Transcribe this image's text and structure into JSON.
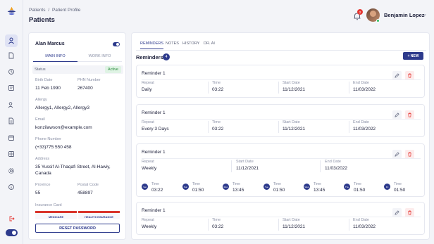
{
  "breadcrumb": {
    "root": "Patients",
    "separator": "/",
    "current": "Patient Profile"
  },
  "page_title": "Patients",
  "header": {
    "notification_count": "2",
    "user_name": "Benjamin Lopez"
  },
  "patient": {
    "name": "Alan Marcus",
    "tabs": [
      "MAIN INFO",
      "WORK INFO"
    ],
    "status_label": "Status",
    "status_value": "Active",
    "birth_date_label": "Birth Date",
    "birth_date": "11 Feb 1990",
    "phn_label": "PHN Number",
    "phn": "267400",
    "allergy_label": "Allergy",
    "allergy": "Allergy1, Allergy2, Allergy3",
    "email_label": "Email",
    "email": "konzilawson@example.com",
    "phone_label": "Phone Number",
    "phone": "(+33)775 550 458",
    "address_label": "Address",
    "address": "35 Yussif Al-Thaqafi Street, Al-Hawiy, Canada",
    "province_label": "Province",
    "province": "55",
    "postal_label": "Postal Code",
    "postal": "458897",
    "insurance_label": "Insurance Card",
    "insurance_cards": [
      "MEDICARE",
      "HEALTH INSURANCE"
    ],
    "reset_label": "RESET PASSWORD"
  },
  "main": {
    "tabs": [
      "REMINDERS",
      "NOTES",
      "HISTORY",
      "DR. AI"
    ],
    "reminders_title": "Reminders",
    "reminders_count": "4",
    "new_label": "+ NEW",
    "col_labels": {
      "repeat": "Repeat",
      "time": "Time",
      "start": "Start Date",
      "end": "End Date"
    },
    "reminders": [
      {
        "name": "Reminder 1",
        "repeat": "Daily",
        "time": "03:22",
        "start": "11/12/2021",
        "end": "11/03/2022"
      },
      {
        "name": "Reminder 1",
        "repeat": "Every 3 Days",
        "time": "03:22",
        "start": "11/12/2021",
        "end": "11/03/2022"
      },
      {
        "name": "Reminder 1",
        "repeat": "Weekly",
        "start": "11/12/2021",
        "end": "11/03/2022",
        "days": [
          {
            "day": "Sat",
            "time": "03:22"
          },
          {
            "day": "Sun",
            "time": "01:50"
          },
          {
            "day": "Mon",
            "time": "13:45"
          },
          {
            "day": "Tue",
            "time": "01:50"
          },
          {
            "day": "Wed",
            "time": "13:45"
          },
          {
            "day": "Thu",
            "time": "01:50"
          },
          {
            "day": "Fri",
            "time": "01:50"
          }
        ],
        "time_label": "Time"
      },
      {
        "name": "Reminder 1",
        "repeat": "Weekly",
        "time": "03:22",
        "start": "11/12/2021",
        "end": "11/03/2022"
      }
    ]
  },
  "colors": {
    "accent": "#2d3a8c",
    "danger": "#e53935",
    "success": "#2b8a3e"
  }
}
